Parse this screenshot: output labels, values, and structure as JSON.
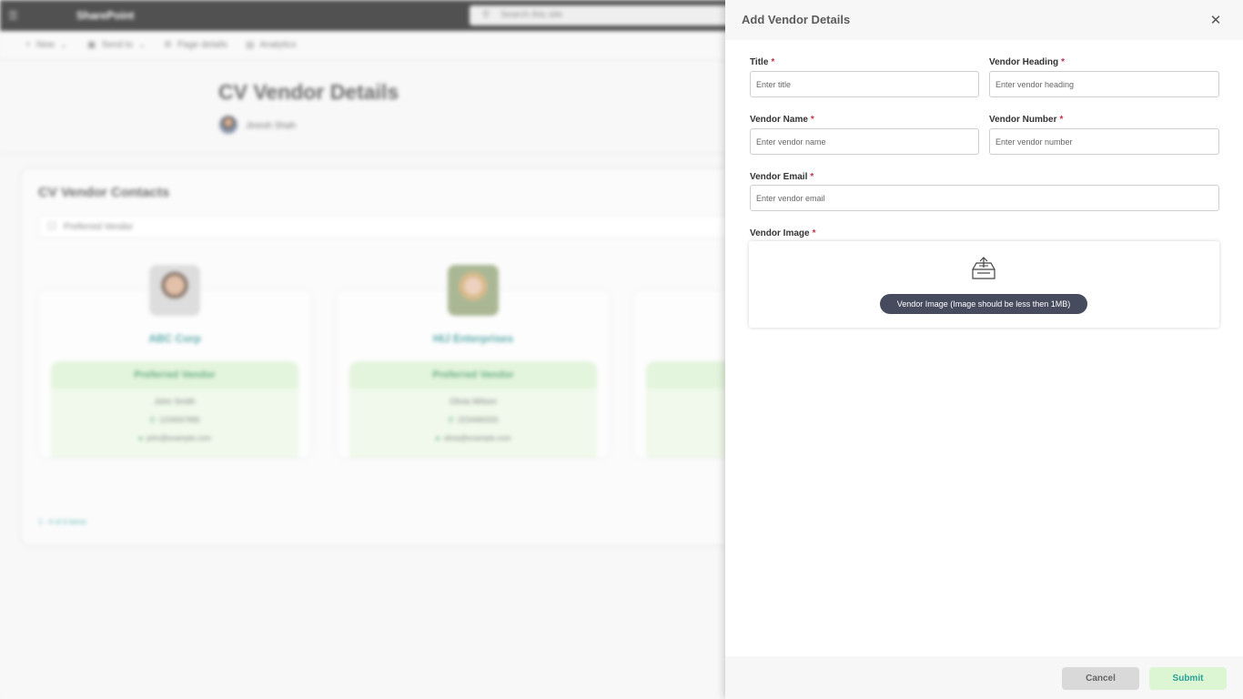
{
  "app": {
    "brand": "SharePoint",
    "search_placeholder": "Search this site"
  },
  "command_bar": {
    "items": [
      {
        "icon": "plus-icon",
        "label": "New"
      },
      {
        "icon": "send-icon",
        "label": "Send to"
      },
      {
        "icon": "gear-icon",
        "label": "Page details"
      },
      {
        "icon": "chart-icon",
        "label": "Analytics"
      }
    ]
  },
  "page": {
    "title": "CV Vendor Details",
    "author": "Jinesh Shah"
  },
  "contacts": {
    "title": "CV Vendor Contacts",
    "filter_label": "Preferred Vendor",
    "pager": "1 - 4 of 4 items",
    "cards": [
      {
        "company": "ABC Corp",
        "badge": "Preferred Vendor",
        "person": "John Smith",
        "phone": "1234567890",
        "email": "john@example.com"
      },
      {
        "company": "HIJ Enterprises",
        "badge": "Preferred Vendor",
        "person": "Olivia Wilson",
        "phone": "2234465555",
        "email": "olivia@example.com"
      },
      {
        "company": "",
        "badge": "",
        "person": "",
        "phone": "",
        "email": ""
      }
    ]
  },
  "panel": {
    "title": "Add Vendor Details",
    "fields": {
      "title": {
        "label": "Title",
        "required": "*",
        "placeholder": "Enter title",
        "value": ""
      },
      "vendor_heading": {
        "label": "Vendor Heading",
        "required": "*",
        "placeholder": "Enter vendor heading",
        "value": ""
      },
      "vendor_name": {
        "label": "Vendor Name",
        "required": "*",
        "placeholder": "Enter vendor name",
        "value": ""
      },
      "vendor_number": {
        "label": "Vendor Number",
        "required": "*",
        "placeholder": "Enter vendor number",
        "value": ""
      },
      "vendor_email": {
        "label": "Vendor Email",
        "required": "*",
        "placeholder": "Enter vendor email",
        "value": ""
      },
      "vendor_image": {
        "label": "Vendor Image",
        "required": "*",
        "hint": "Vendor Image (Image should be less then 1MB)",
        "icon": "upload-tray-icon"
      }
    },
    "buttons": {
      "cancel": "Cancel",
      "submit": "Submit"
    }
  },
  "colors": {
    "accent_teal": "#2aa198",
    "required_red": "#c4314b",
    "badge_green": "#d9f1cf",
    "hint_pill": "#464b5e"
  }
}
